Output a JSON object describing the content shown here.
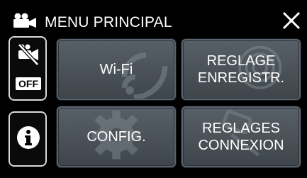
{
  "header": {
    "title": "MENU PRINCIPAL",
    "close_icon": "close-icon",
    "camera_icon": "movie-camera-icon"
  },
  "side": {
    "mute_badge": "OFF",
    "mute_icon": "no-camera-sound-icon",
    "info_icon": "info-icon"
  },
  "tiles": [
    {
      "lines": [
        "Wi-Fi"
      ],
      "icon": "wifi-icon"
    },
    {
      "lines": [
        "REGLAGE",
        "ENREGISTR."
      ],
      "icon": "record-settings-icon"
    },
    {
      "lines": [
        "CONFIG."
      ],
      "icon": "gear-icon"
    },
    {
      "lines": [
        "REGLAGES",
        "CONNEXION"
      ],
      "icon": "connection-settings-icon"
    }
  ],
  "colors": {
    "background": "#000000",
    "tile_top": "#586067",
    "tile_bottom": "#3e454b",
    "text": "#ffffff"
  }
}
